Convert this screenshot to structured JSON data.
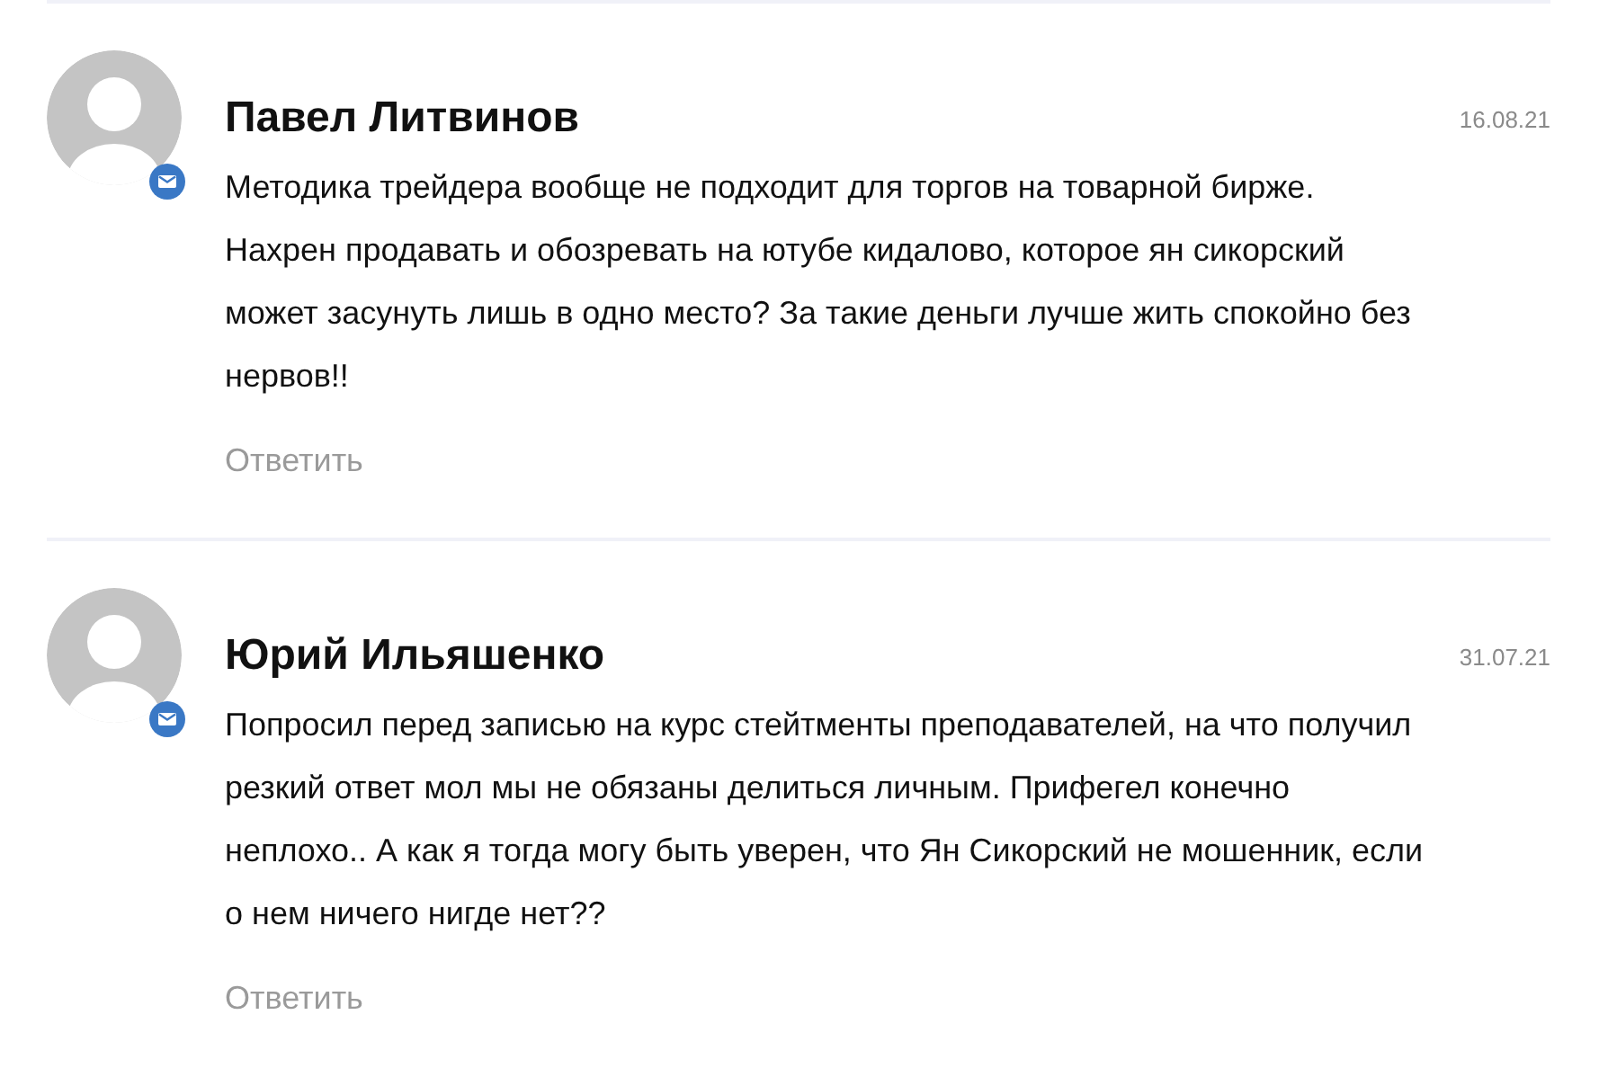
{
  "comments": [
    {
      "author": "Павел Литвинов",
      "date": "16.08.21",
      "text": "Методика трейдера вообще не подходит для торгов на товарной бирже.\nНахрен продавать и обозревать на ютубе кидалово, которое ян сикорский\nможет засунуть лишь в одно место? За такие деньги лучше жить спокойно без\nнервов!!",
      "reply": "Ответить"
    },
    {
      "author": "Юрий Ильяшенко",
      "date": "31.07.21",
      "text": "Попросил перед записью на курс стейтменты преподавателей, на что получил\nрезкий ответ мол мы не обязаны делиться личным. Прифегел конечно\nнеплохо.. А как я тогда могу быть уверен, что Ян Сикорский не мошенник, если\nо нем ничего нигде нет??",
      "reply": "Ответить"
    }
  ]
}
